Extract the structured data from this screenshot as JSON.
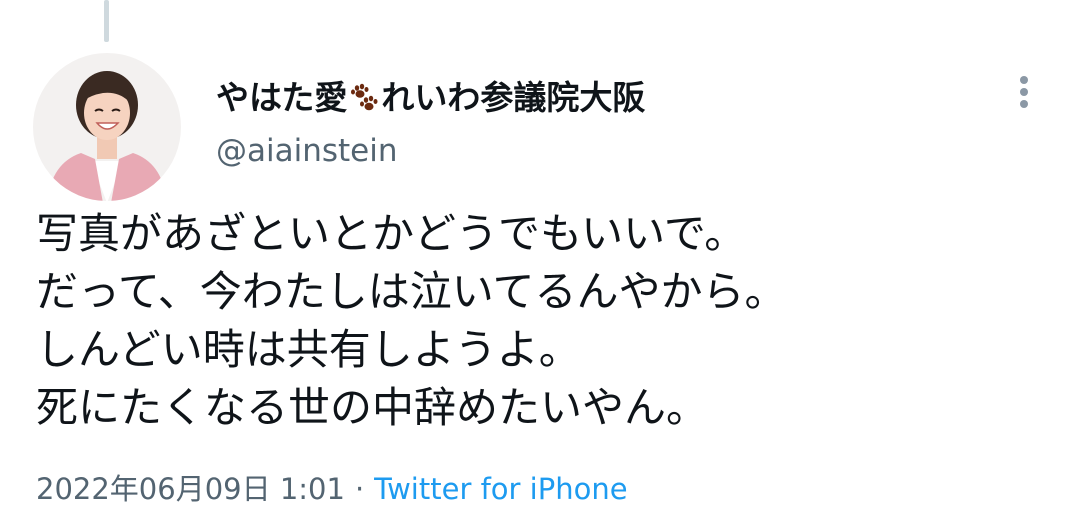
{
  "user": {
    "name_part1": "やはた愛",
    "name_part2": "れいわ参議院大阪",
    "handle": "@aiainstein",
    "name_icon": "paw-prints-icon",
    "avatar_icon": "profile-avatar"
  },
  "tweet": {
    "lines": [
      "写真があざといとかどうでもいいで。",
      "だって、今わたしは泣いてるんやから。",
      "しんどい時は共有しようよ。",
      "死にたくなる世の中辞めたいやん。"
    ]
  },
  "meta": {
    "date": "2022年06月09日",
    "time": "1:01",
    "separator": "·",
    "source": "Twitter for iPhone"
  },
  "colors": {
    "text": "#0f1419",
    "secondary": "#536471",
    "link": "#1d9bf0",
    "paw": "#6b2a10",
    "thread_line": "#cfd9de"
  },
  "icons": {
    "more": "more-vertical-icon"
  }
}
